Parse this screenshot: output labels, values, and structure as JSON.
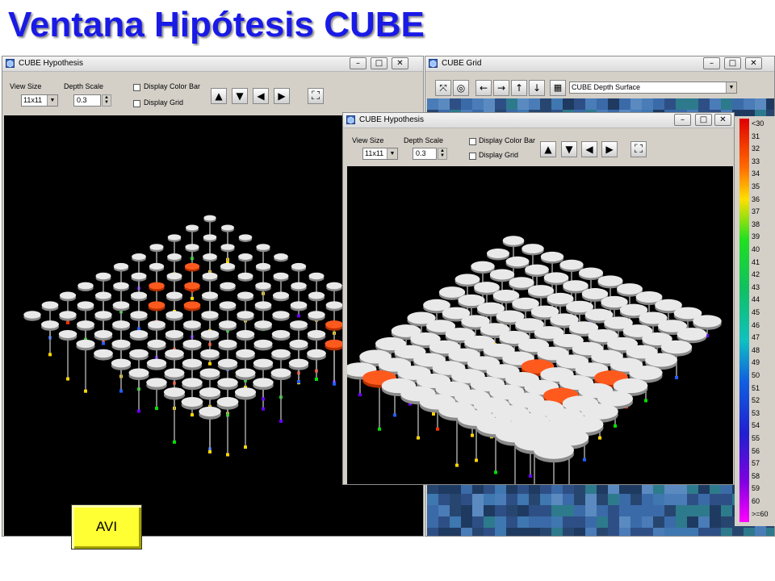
{
  "slide": {
    "title": "Ventana Hipótesis CUBE"
  },
  "colors": {
    "title": "#1a1ae6",
    "button": "#ffff33",
    "selected": "#ff5a1e"
  },
  "win_left": {
    "title": "CUBE Hypothesis",
    "view_size_label": "View Size",
    "view_size_value": "11x11",
    "depth_scale_label": "Depth Scale",
    "depth_scale_value": "0.3",
    "display_color_bar": "Display Color Bar",
    "display_grid": "Display Grid"
  },
  "win_grid": {
    "title": "CUBE Grid",
    "surface_value": "CUBE Depth Surface"
  },
  "win_front": {
    "title": "CUBE Hypothesis",
    "view_size_label": "View Size",
    "view_size_value": "11x11",
    "depth_scale_label": "Depth Scale",
    "depth_scale_value": "0.3",
    "display_color_bar": "Display Color Bar",
    "display_grid": "Display Grid"
  },
  "legend": {
    "labels": [
      "<30",
      "31",
      "32",
      "33",
      "34",
      "35",
      "36",
      "37",
      "38",
      "39",
      "40",
      "41",
      "42",
      "43",
      "44",
      "45",
      "46",
      "47",
      "48",
      "49",
      "50",
      "51",
      "52",
      "53",
      "54",
      "55",
      "56",
      "57",
      "58",
      "59",
      "60",
      ">=60"
    ]
  },
  "avi": {
    "label": "AVI"
  },
  "icons": {
    "window": "cube-window-icon",
    "minimize": "minimize-icon",
    "maximize": "maximize-icon",
    "close": "close-icon",
    "up": "arrow-up-icon",
    "down": "arrow-down-icon",
    "left": "arrow-left-icon",
    "right": "arrow-right-icon",
    "fit": "fit-view-icon"
  }
}
